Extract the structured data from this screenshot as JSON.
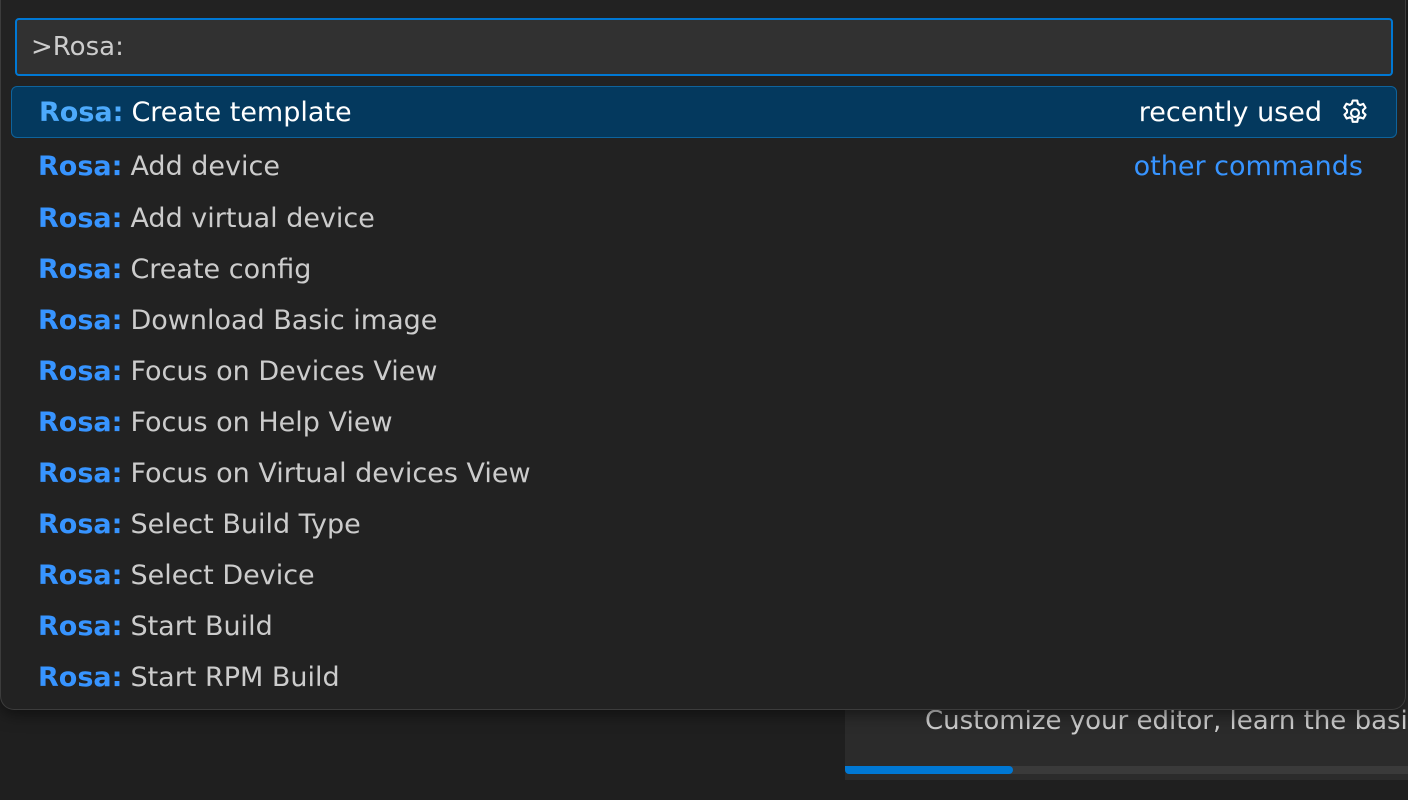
{
  "palette": {
    "query": ">Rosa:",
    "prefix": "Rosa:",
    "recent_label": "recently used",
    "other_label": "other commands",
    "gear_icon": "gear-icon",
    "items": [
      {
        "label": "Create template"
      },
      {
        "label": "Add device"
      },
      {
        "label": "Add virtual device"
      },
      {
        "label": "Create config"
      },
      {
        "label": "Download Basic image"
      },
      {
        "label": "Focus on Devices View"
      },
      {
        "label": "Focus on Help View"
      },
      {
        "label": "Focus on Virtual devices View"
      },
      {
        "label": "Select Build Type"
      },
      {
        "label": "Select Device"
      },
      {
        "label": "Start Build"
      },
      {
        "label": "Start RPM Build"
      }
    ]
  },
  "background": {
    "card_text": "Customize your editor, learn the basics",
    "progress_fraction": 0.28
  },
  "colors": {
    "accent": "#0078d4",
    "prefix": "#3794ff",
    "selected_bg": "#04395e",
    "panel_bg": "#222222"
  }
}
